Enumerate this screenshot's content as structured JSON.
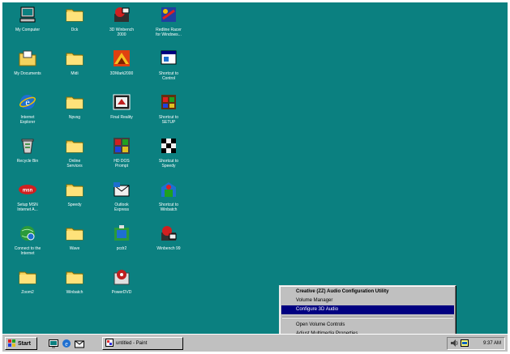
{
  "colors": {
    "desktop": "#0b8080",
    "menu_highlight": "#000080",
    "taskbar": "#c0c0c0"
  },
  "desktop_icons": [
    {
      "label": "My Computer",
      "icon": "computer-icon"
    },
    {
      "label": "My Documents",
      "icon": "documents-icon"
    },
    {
      "label": "Internet\nExplorer",
      "icon": "internet-explorer-icon"
    },
    {
      "label": "Recycle Bin",
      "icon": "recycle-bin-icon"
    },
    {
      "label": "Setup MSN\nInternet A...",
      "icon": "msn-icon"
    },
    {
      "label": "Connect to the\nInternet",
      "icon": "connect-internet-icon"
    },
    {
      "label": "Zoom2",
      "icon": "folder-icon"
    },
    {
      "label": "Dck",
      "icon": "folder-icon"
    },
    {
      "label": "Midi",
      "icon": "folder-icon"
    },
    {
      "label": "Npvsg",
      "icon": "folder-icon"
    },
    {
      "label": "Online\nServices",
      "icon": "folder-icon"
    },
    {
      "label": "Speedy",
      "icon": "folder-icon"
    },
    {
      "label": "Wave",
      "icon": "folder-icon"
    },
    {
      "label": "Winbatch",
      "icon": "folder-icon"
    },
    {
      "label": "3D Winbench\n2000",
      "icon": "winbench-icon"
    },
    {
      "label": "3DMark2000",
      "icon": "3dmark-icon"
    },
    {
      "label": "Final Reality",
      "icon": "final-reality-icon"
    },
    {
      "label": "HD DOS\nPrompt",
      "icon": "dos-prompt-icon"
    },
    {
      "label": "Outlook\nExpress",
      "icon": "outlook-express-icon"
    },
    {
      "label": "pcdr2",
      "icon": "pcdr-icon"
    },
    {
      "label": "PowerDVD",
      "icon": "powerdvd-icon"
    },
    {
      "label": "Redline Racer\nfor Windows...",
      "icon": "redline-racer-icon"
    },
    {
      "label": "Shortcut to\nControl",
      "icon": "shortcut-control-icon"
    },
    {
      "label": "Shortcut to\nSETUP",
      "icon": "shortcut-setup-icon"
    },
    {
      "label": "Shortcut to\nSpeedy",
      "icon": "shortcut-speedy-icon"
    },
    {
      "label": "Shortcut to\nWinbatch",
      "icon": "shortcut-winbatch-icon"
    },
    {
      "label": "Winbench 99",
      "icon": "winbench99-icon"
    }
  ],
  "context_menu": {
    "title": "Creative (ZZ) Audio Configuration Utility",
    "items": [
      {
        "label": "Volume Manager",
        "selected": false
      },
      {
        "label": "Configure 3D Audio",
        "selected": true
      },
      {
        "label": "Open Volume Controls",
        "selected": false
      },
      {
        "label": "Adjust Multimedia Properties",
        "selected": false
      }
    ]
  },
  "taskbar": {
    "start_label": "Start",
    "quick_launch": [
      "desktop-icon",
      "internet-explorer-icon",
      "outlook-express-icon"
    ],
    "task_button_label": "untitled - Paint",
    "clock": "9:37 AM"
  }
}
